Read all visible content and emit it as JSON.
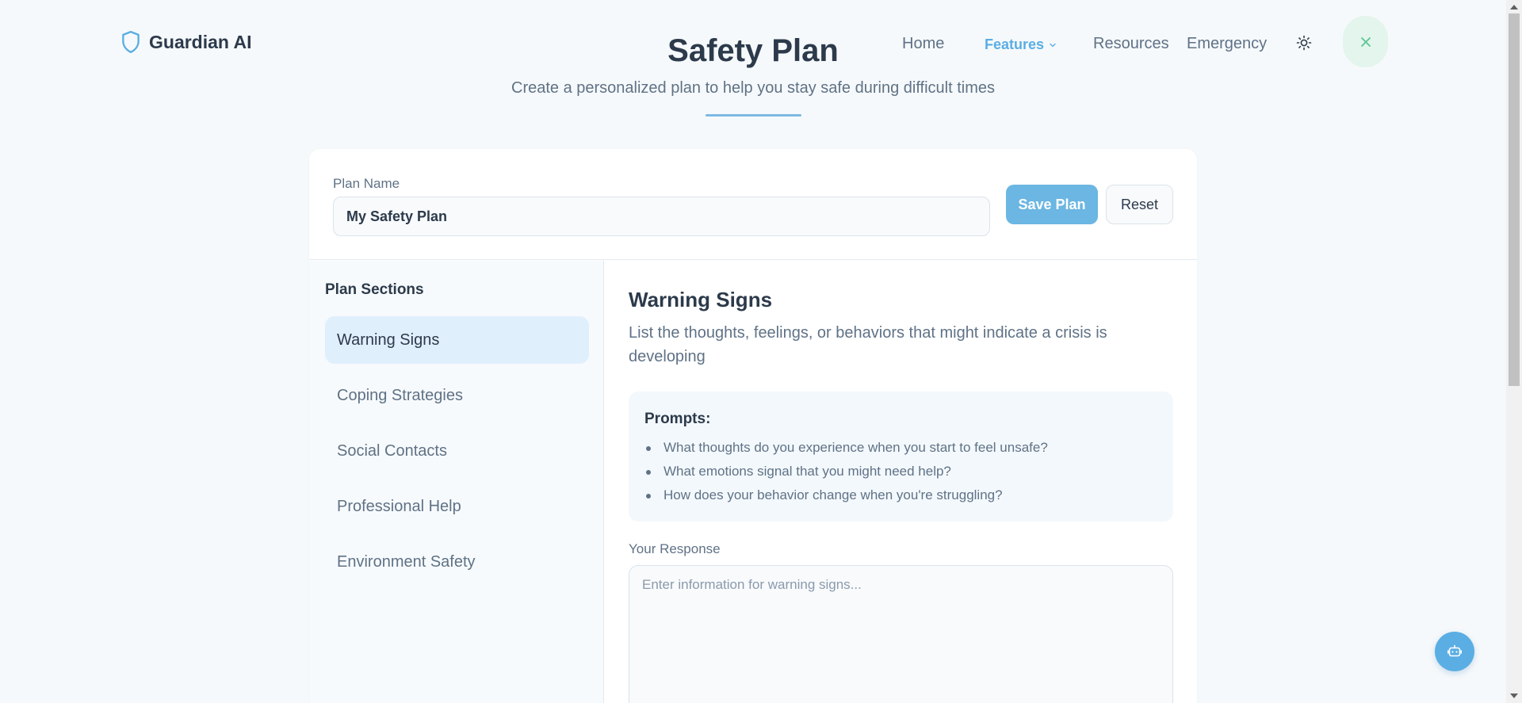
{
  "header": {
    "brand": "Guardian AI",
    "nav": {
      "home": "Home",
      "features": "Features",
      "resources": "Resources",
      "emergency": "Emergency"
    }
  },
  "page": {
    "title": "Safety Plan",
    "subtitle": "Create a personalized plan to help you stay safe during difficult times"
  },
  "plan": {
    "name_label": "Plan Name",
    "name_value": "My Safety Plan",
    "save_label": "Save Plan",
    "reset_label": "Reset"
  },
  "sections": {
    "title": "Plan Sections",
    "items": [
      {
        "label": "Warning Signs",
        "active": true
      },
      {
        "label": "Coping Strategies",
        "active": false
      },
      {
        "label": "Social Contacts",
        "active": false
      },
      {
        "label": "Professional Help",
        "active": false
      },
      {
        "label": "Environment Safety",
        "active": false
      }
    ]
  },
  "content": {
    "title": "Warning Signs",
    "description": "List the thoughts, feelings, or behaviors that might indicate a crisis is developing",
    "prompts_title": "Prompts:",
    "prompts": [
      "What thoughts do you experience when you start to feel unsafe?",
      "What emotions signal that you might need help?",
      "How does your behavior change when you're struggling?"
    ],
    "response_label": "Your Response",
    "response_placeholder": "Enter information for warning signs...",
    "response_value": ""
  },
  "icons": {
    "logo": "shield-icon",
    "features_caret": "chevron-down-icon",
    "theme_toggle": "sun-icon",
    "close": "close-icon",
    "assistant": "robot-icon"
  },
  "colors": {
    "accent": "#5aaee3",
    "active_section_bg": "#e0effc",
    "close_button_bg": "#e3f5ec",
    "close_icon": "#5cc592"
  }
}
